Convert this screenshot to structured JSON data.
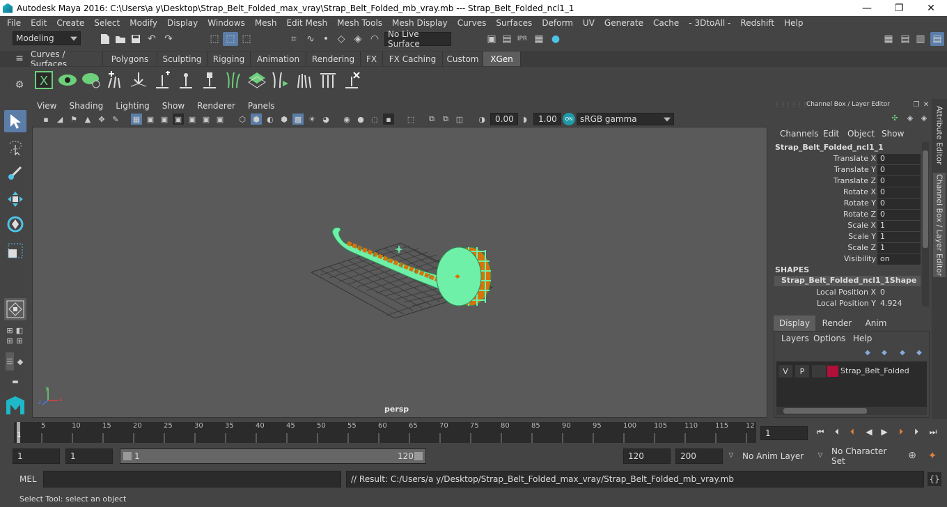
{
  "window": {
    "title": "Autodesk Maya 2016: C:\\Users\\a y\\Desktop\\Strap_Belt_Folded_max_vray\\Strap_Belt_Folded_mb_vray.mb   ---   Strap_Belt_Folded_ncl1_1",
    "minimize": "—",
    "maximize": "❐",
    "close": "✕"
  },
  "menu": [
    "File",
    "Edit",
    "Create",
    "Select",
    "Modify",
    "Display",
    "Windows",
    "Mesh",
    "Edit Mesh",
    "Mesh Tools",
    "Mesh Display",
    "Curves",
    "Surfaces",
    "Deform",
    "UV",
    "Generate",
    "Cache",
    "- 3DtoAll -",
    "Redshift",
    "Help"
  ],
  "status": {
    "mode": "Modeling",
    "live_surface": "No Live Surface"
  },
  "shelf_tabs": [
    {
      "label": "Curves / Surfaces",
      "active": false
    },
    {
      "label": "Polygons",
      "active": false
    },
    {
      "label": "Sculpting",
      "active": false
    },
    {
      "label": "Rigging",
      "active": false
    },
    {
      "label": "Animation",
      "active": false
    },
    {
      "label": "Rendering",
      "active": false
    },
    {
      "label": "FX",
      "active": false
    },
    {
      "label": "FX Caching",
      "active": false
    },
    {
      "label": "Custom",
      "active": false
    },
    {
      "label": "XGen",
      "active": true
    }
  ],
  "panel_menu": [
    "View",
    "Shading",
    "Lighting",
    "Show",
    "Renderer",
    "Panels"
  ],
  "panel_toolbar": {
    "exposure": "0.00",
    "gamma": "1.00",
    "color_space": "sRGB gamma"
  },
  "viewport": {
    "camera": "persp",
    "mesh_color": "#6ef0a8",
    "mesh_accent": "#d4740a",
    "axis_labels": {
      "x": "x",
      "y": "y",
      "z": "z"
    }
  },
  "channel_box": {
    "header": "Channel Box / Layer Editor",
    "menus": [
      "Channels",
      "Edit",
      "Object",
      "Show"
    ],
    "object_name": "Strap_Belt_Folded_ncl1_1",
    "attributes": [
      {
        "name": "Translate X",
        "value": "0"
      },
      {
        "name": "Translate Y",
        "value": "0"
      },
      {
        "name": "Translate Z",
        "value": "0"
      },
      {
        "name": "Rotate X",
        "value": "0"
      },
      {
        "name": "Rotate Y",
        "value": "0"
      },
      {
        "name": "Rotate Z",
        "value": "0"
      },
      {
        "name": "Scale X",
        "value": "1"
      },
      {
        "name": "Scale Y",
        "value": "1"
      },
      {
        "name": "Scale Z",
        "value": "1"
      },
      {
        "name": "Visibility",
        "value": "on"
      }
    ],
    "shapes_header": "SHAPES",
    "shape_name": "Strap_Belt_Folded_ncl1_1Shape",
    "shape_attributes": [
      {
        "name": "Local Position X",
        "value": "0"
      },
      {
        "name": "Local Position Y",
        "value": "4.924"
      }
    ]
  },
  "layer_editor": {
    "tabs": [
      {
        "label": "Display",
        "active": true
      },
      {
        "label": "Render",
        "active": false
      },
      {
        "label": "Anim",
        "active": false
      }
    ],
    "menus": [
      "Layers",
      "Options",
      "Help"
    ],
    "layer": {
      "visible": "V",
      "playback": "P",
      "name": "Strap_Belt_Folded",
      "color": "#b0103a"
    }
  },
  "side_tabs": [
    "Attribute Editor",
    "Channel Box / Layer Editor"
  ],
  "timeline": {
    "ticks": [
      "1",
      "5",
      "10",
      "15",
      "20",
      "25",
      "30",
      "35",
      "40",
      "45",
      "50",
      "55",
      "60",
      "65",
      "70",
      "75",
      "80",
      "85",
      "90",
      "95",
      "100",
      "105",
      "110",
      "115",
      "12"
    ],
    "current_frame": "1"
  },
  "range": {
    "start": "1",
    "playback_start": "1",
    "slider_start": "1",
    "slider_end": "120",
    "playback_end": "120",
    "end": "200",
    "anim_layer": "No Anim Layer",
    "character_set": "No Character Set"
  },
  "command": {
    "label": "MEL",
    "result": "// Result: C:/Users/a y/Desktop/Strap_Belt_Folded_max_vray/Strap_Belt_Folded_mb_vray.mb"
  },
  "help_line": "Select Tool: select an object"
}
